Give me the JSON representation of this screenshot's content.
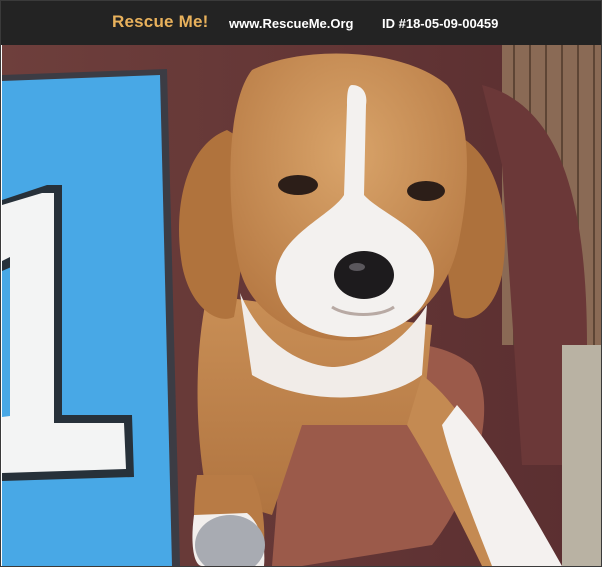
{
  "header": {
    "brand": "Rescue Me!",
    "site": "www.RescueMe.Org",
    "pet_id": "ID #18-05-09-00459"
  },
  "colors": {
    "header_bg": "#232323",
    "brand": "#e8b15c",
    "header_text": "#ffffff"
  },
  "photo": {
    "sign_number": "1"
  }
}
